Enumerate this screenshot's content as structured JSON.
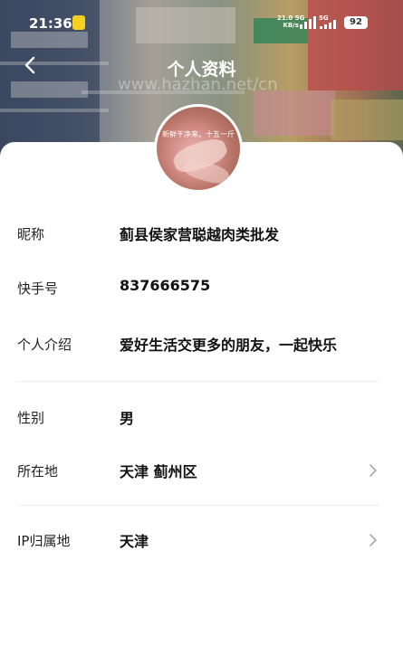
{
  "status_bar": {
    "time": "21:36",
    "net_speed": "21.0",
    "net_unit": "KB/s",
    "net_type_1": "5G",
    "net_type_2": "5G",
    "battery": "92"
  },
  "header": {
    "title": "个人资料",
    "watermark": "www.hazhan.net/cn"
  },
  "avatar": {
    "caption": "新鲜干净来，十五一斤"
  },
  "profile": {
    "nickname_label": "昵称",
    "nickname": "蓟县侯家营聪越肉类批发",
    "kuaishou_id_label": "快手号",
    "kuaishou_id": "837666575",
    "bio_label": "个人介绍",
    "bio": "爱好生活交更多的朋友，一起快乐",
    "gender_label": "性别",
    "gender": "男",
    "location_label": "所在地",
    "location": "天津 蓟州区",
    "ip_label": "IP归属地",
    "ip_location": "天津"
  },
  "icons": {
    "back": "back-arrow-icon",
    "chevron": "chevron-right-icon"
  }
}
